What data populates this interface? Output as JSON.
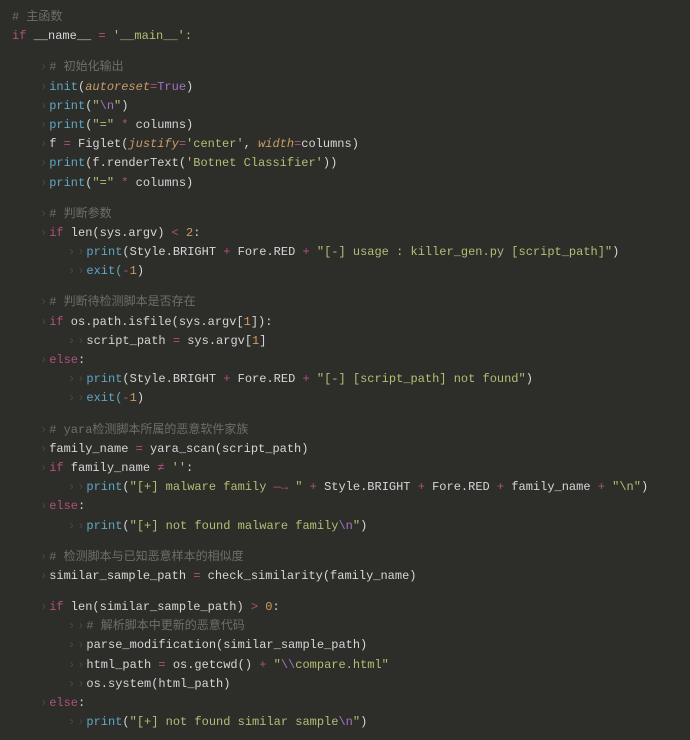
{
  "code": {
    "l1": "# 主函数",
    "l2a": "if",
    "l2b": " __name__ ",
    "l2c": "=",
    "l2d": " '",
    "l2e": "__main__",
    "l2f": "':",
    "l3": "# 初始化输出",
    "l4a": "init",
    "l4b": "(",
    "l4c": "autoreset",
    "l4d": "=",
    "l4e": "True",
    "l4f": ")",
    "l5a": "print",
    "l5b": "(",
    "l5c": "\"",
    "l5d": "\\n",
    "l5e": "\"",
    "l5f": ")",
    "l6a": "print",
    "l6b": "(",
    "l6c": "\"=\"",
    "l6d": " * ",
    "l6e": "columns)",
    "l7a": "f ",
    "l7b": "=",
    "l7c": " Figlet(",
    "l7d": "justify",
    "l7e": "=",
    "l7f": "'center'",
    "l7g": ", ",
    "l7h": "width",
    "l7i": "=",
    "l7j": "columns)",
    "l8a": "print",
    "l8b": "(f.renderText(",
    "l8c": "'Botnet Classifier'",
    "l8d": "))",
    "l9a": "print",
    "l9b": "(",
    "l9c": "\"=\"",
    "l9d": " * ",
    "l9e": "columns)",
    "l10": "# 判断参数",
    "l11a": "if",
    "l11b": " len(sys.argv) ",
    "l11c": "<",
    "l11d": " ",
    "l11e": "2",
    "l11f": ":",
    "l12a": "print",
    "l12b": "(Style.BRIGHT ",
    "l12c": "+",
    "l12d": " Fore.RED ",
    "l12e": "+",
    "l12f": " ",
    "l12g": "\"[-] usage : killer_gen.py [script_path]\"",
    "l12h": ")",
    "l13a": "exit(",
    "l13b": "-",
    "l13c": "1",
    "l13d": ")",
    "l14": "# 判断待检测脚本是否存在",
    "l15a": "if",
    "l15b": " os.path.isfile(sys.argv[",
    "l15c": "1",
    "l15d": "]):",
    "l16a": "script_path ",
    "l16b": "=",
    "l16c": " sys.argv[",
    "l16d": "1",
    "l16e": "]",
    "l17a": "else",
    "l17b": ":",
    "l18a": "print",
    "l18b": "(Style.BRIGHT ",
    "l18c": "+",
    "l18d": " Fore.RED ",
    "l18e": "+",
    "l18f": " ",
    "l18g": "\"[-] [script_path] not found\"",
    "l18h": ")",
    "l19a": "exit(",
    "l19b": "-",
    "l19c": "1",
    "l19d": ")",
    "l20": "# yara检测脚本所属的恶意软件家族",
    "l21a": "family_name ",
    "l21b": "=",
    "l21c": " yara_scan(script_path)",
    "l22a": "if",
    "l22b": " family_name ",
    "l22c": "≠",
    "l22d": " ",
    "l22e": "''",
    "l22f": ":",
    "l23a": "print",
    "l23b": "(",
    "l23c": "\"[+] malware family ",
    "l23d": "—→",
    "l23e": " \"",
    "l23f": " + ",
    "l23g": "Style.BRIGHT ",
    "l23h": "+",
    "l23i": " Fore.RED ",
    "l23j": "+",
    "l23k": " family_name ",
    "l23l": "+",
    "l23m": " ",
    "l23n": "\"\\n\"",
    "l23o": ")",
    "l24a": "else",
    "l24b": ":",
    "l25a": "print",
    "l25b": "(",
    "l25c": "\"[+] not found malware family",
    "l25d": "\\n",
    "l25e": "\"",
    "l25f": ")",
    "l26": "# 检测脚本与已知恶意样本的相似度",
    "l27a": "similar_sample_path ",
    "l27b": "=",
    "l27c": " check_similarity(family_name)",
    "l28a": "if",
    "l28b": " len(similar_sample_path) ",
    "l28c": ">",
    "l28d": " ",
    "l28e": "0",
    "l28f": ":",
    "l29": "# 解析脚本中更新的恶意代码",
    "l30a": "parse_modification(similar_sample_path)",
    "l31a": "html_path ",
    "l31b": "=",
    "l31c": " os.getcwd() ",
    "l31d": "+",
    "l31e": " ",
    "l31f": "\"",
    "l31g": "\\\\",
    "l31h": "compare.html\"",
    "l32a": "os.system(html_path)",
    "l33a": "else",
    "l33b": ":",
    "l34a": "print",
    "l34b": "(",
    "l34c": "\"[+] not found similar sample",
    "l34d": "\\n",
    "l34e": "\"",
    "l34f": ")"
  }
}
